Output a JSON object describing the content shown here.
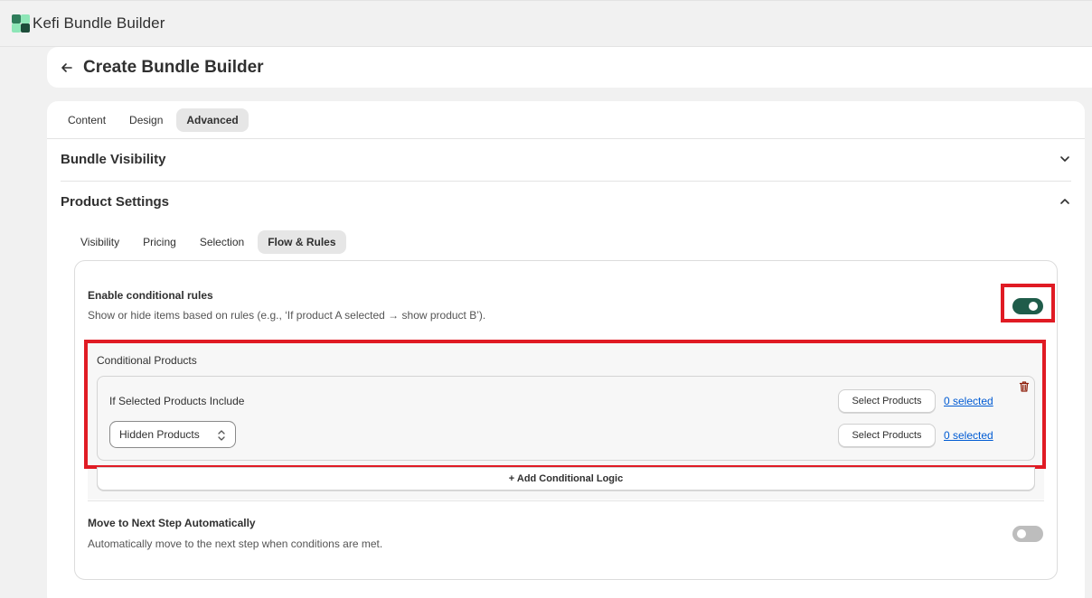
{
  "app": {
    "title": "Kefi Bundle Builder",
    "logo_icon": "kefi-logo-icon"
  },
  "header": {
    "title": "Create Bundle Builder",
    "back_icon": "back-arrow-icon"
  },
  "main_tabs": [
    {
      "label": "Content",
      "active": false
    },
    {
      "label": "Design",
      "active": false
    },
    {
      "label": "Advanced",
      "active": true
    }
  ],
  "sections": {
    "bundle_visibility": {
      "title": "Bundle Visibility",
      "expanded": false
    },
    "product_settings": {
      "title": "Product Settings",
      "expanded": true
    }
  },
  "product_tabs": [
    {
      "label": "Visibility",
      "active": false
    },
    {
      "label": "Pricing",
      "active": false
    },
    {
      "label": "Selection",
      "active": false
    },
    {
      "label": "Flow & Rules",
      "active": true
    }
  ],
  "conditional_rules": {
    "title": "Enable conditional rules",
    "description": "Show or hide items based on rules (e.g., ‘If product A selected → show product B’).",
    "enabled": true
  },
  "conditional_products": {
    "label": "Conditional Products",
    "rule": {
      "if_label": "If Selected Products Include",
      "select_button_1": "Select Products",
      "selected_link_1": "0 selected",
      "action_value": "Hidden Products",
      "select_button_2": "Select Products",
      "selected_link_2": "0 selected"
    },
    "add_button": "+ Add Conditional Logic"
  },
  "auto_next": {
    "title": "Move to Next Step Automatically",
    "description": "Automatically move to the next step when conditions are met.",
    "enabled": false
  },
  "colors": {
    "toggle_on": "#1f5c4a",
    "toggle_off": "#bdbdbd",
    "link": "#005bd3",
    "highlight": "#e01b24",
    "delete": "#8e1f0b"
  }
}
